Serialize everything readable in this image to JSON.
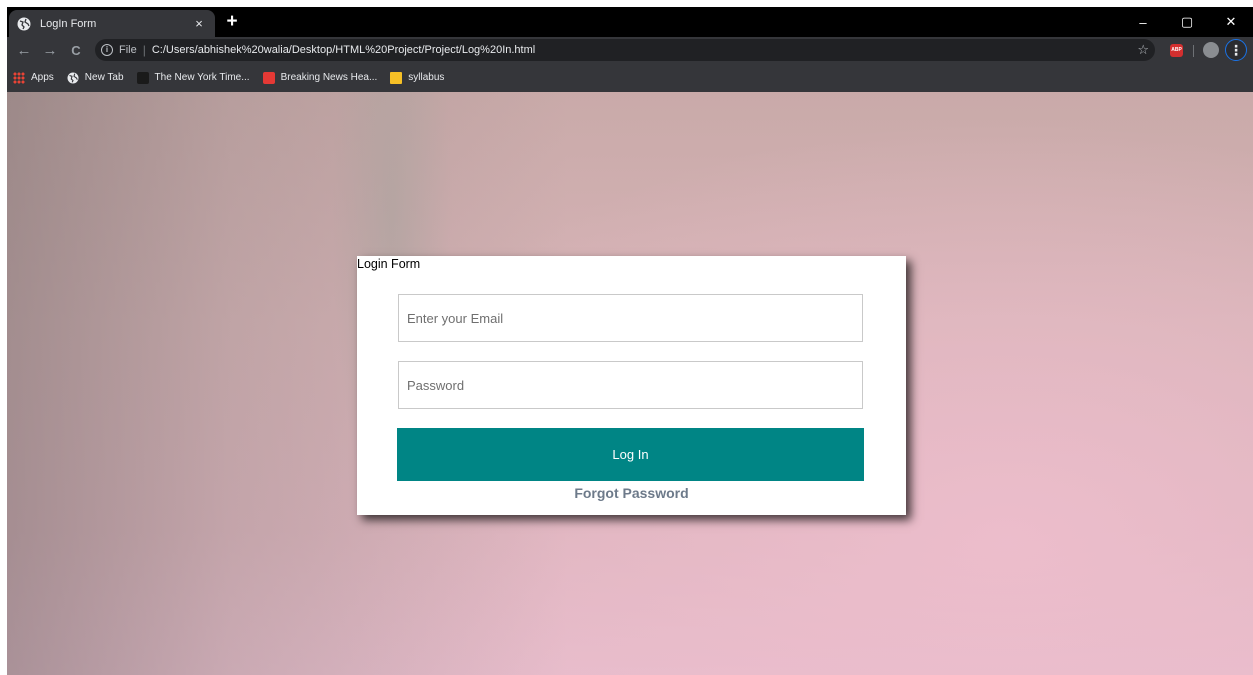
{
  "browser": {
    "tab": {
      "title": "LogIn Form",
      "close_label": "×",
      "favicon": "globe-icon"
    },
    "new_tab_label": "+",
    "window_controls": {
      "minimize": "–",
      "maximize": "▢",
      "close": "✕"
    },
    "toolbar": {
      "back": "←",
      "forward": "→",
      "reload": "C",
      "scheme_label": "File",
      "separator": "|",
      "url": "C:/Users/abhishek%20walia/Desktop/HTML%20Project/Project/Log%20In.html",
      "bookmark_star": "☆",
      "extension_label": "ABP",
      "menu_label": "⋮"
    },
    "bookmarks": [
      {
        "label": "Apps",
        "icon": "apps-grid-icon"
      },
      {
        "label": "New Tab",
        "icon": "globe-icon"
      },
      {
        "label": "The New York Time...",
        "icon": "nyt-icon"
      },
      {
        "label": "Breaking News Hea...",
        "icon": "news-icon"
      },
      {
        "label": "syllabus",
        "icon": "folder-icon"
      }
    ]
  },
  "login": {
    "title": "Login Form",
    "email_placeholder": "Enter your Email",
    "password_placeholder": "Password",
    "submit_label": "Log In",
    "forgot_label": "Forgot Password"
  },
  "colors": {
    "button": "#008585",
    "forgot_link": "#6d7a8a",
    "chrome_dark": "#202124",
    "chrome_toolbar": "#35363a"
  }
}
